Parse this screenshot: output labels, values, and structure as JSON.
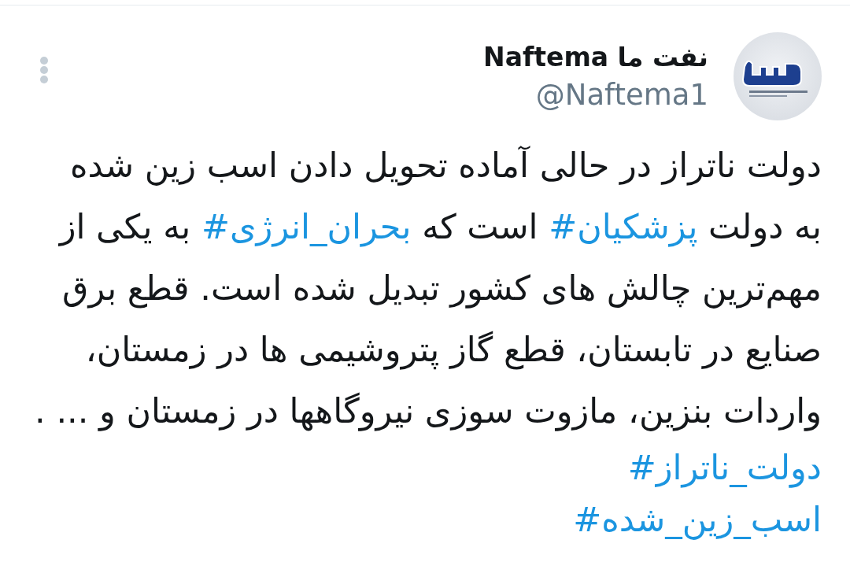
{
  "tweet": {
    "author": {
      "name": "نفت ما Naftema",
      "handle": "@Naftema1"
    },
    "body": {
      "lines": [
        [
          {
            "kind": "text",
            "text": "دولت ناتراز در حالی آماده تحویل دادن اسب زین شده"
          }
        ],
        [
          {
            "kind": "text",
            "text": "به دولت "
          },
          {
            "kind": "hashtag",
            "text": "#پزشکیان"
          },
          {
            "kind": "text",
            "text": " است که "
          },
          {
            "kind": "hashtag",
            "text": "#بحران_انرژی"
          },
          {
            "kind": "text",
            "text": " به یکی از"
          }
        ],
        [
          {
            "kind": "text",
            "text": "مهم‌ترین چالش های کشور تبدیل شده است. قطع برق"
          }
        ],
        [
          {
            "kind": "text",
            "text": "صنایع در تابستان، قطع گاز پتروشیمی ها در زمستان،"
          }
        ],
        [
          {
            "kind": "text",
            "text": "واردات بنزین، مازوت سوزی نیروگاهها در زمستان و ... ."
          }
        ]
      ]
    },
    "hashtags": [
      "#دولت_ناتراز",
      "#اسب_زین_شده"
    ]
  }
}
